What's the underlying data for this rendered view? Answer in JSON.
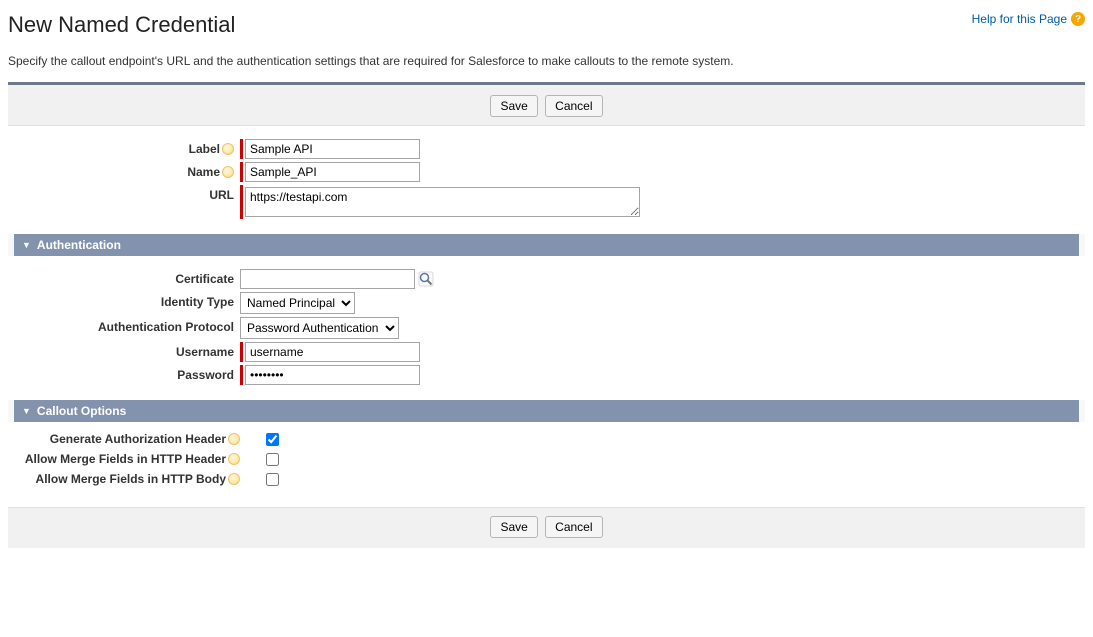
{
  "page_title": "New Named Credential",
  "help_link_text": "Help for this Page",
  "description": "Specify the callout endpoint's URL and the authentication settings that are required for Salesforce to make callouts to the remote system.",
  "buttons": {
    "save": "Save",
    "cancel": "Cancel"
  },
  "fields": {
    "label": {
      "label": "Label",
      "value": "Sample API"
    },
    "name": {
      "label": "Name",
      "value": "Sample_API"
    },
    "url": {
      "label": "URL",
      "value": "https://testapi.com"
    }
  },
  "sections": {
    "auth": {
      "title": "Authentication",
      "certificate": {
        "label": "Certificate",
        "value": ""
      },
      "identity_type": {
        "label": "Identity Type",
        "value": "Named Principal"
      },
      "auth_protocol": {
        "label": "Authentication Protocol",
        "value": "Password Authentication"
      },
      "username": {
        "label": "Username",
        "value": "username"
      },
      "password": {
        "label": "Password",
        "value": "password"
      }
    },
    "callout": {
      "title": "Callout Options",
      "gen_auth_header": {
        "label": "Generate Authorization Header",
        "checked": true
      },
      "merge_header": {
        "label": "Allow Merge Fields in HTTP Header",
        "checked": false
      },
      "merge_body": {
        "label": "Allow Merge Fields in HTTP Body",
        "checked": false
      }
    }
  }
}
